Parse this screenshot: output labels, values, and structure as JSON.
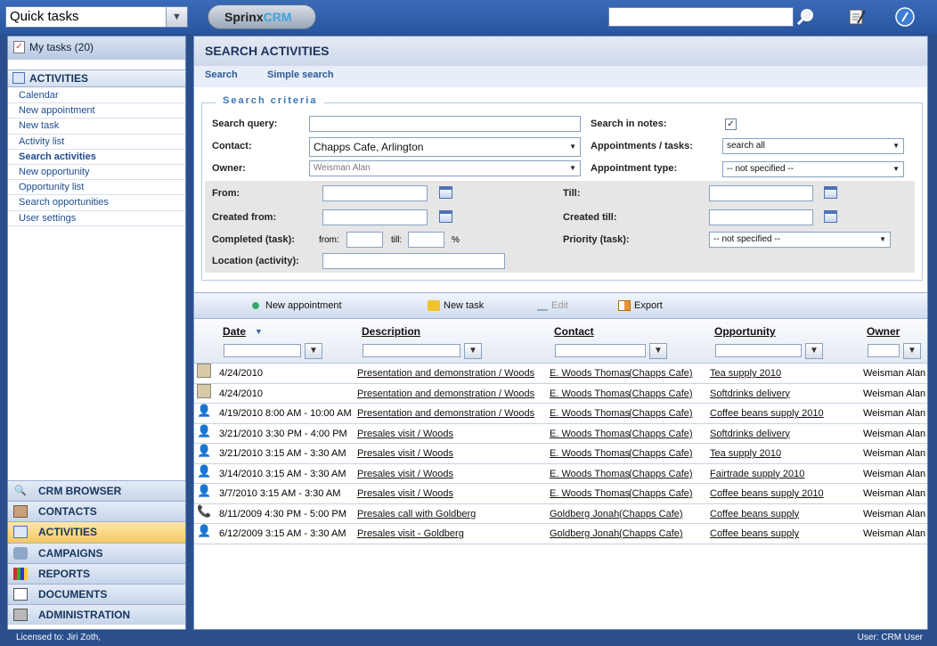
{
  "topbar": {
    "quick_tasks": "Quick tasks",
    "logo_part1": "Sprinx",
    "logo_part2": "CRM",
    "search_placeholder": ""
  },
  "sidebar": {
    "my_tasks": "My tasks (20)",
    "activities_header": "ACTIVITIES",
    "items": [
      {
        "label": "Calendar",
        "selected": false
      },
      {
        "label": "New appointment",
        "selected": false
      },
      {
        "label": "New task",
        "selected": false
      },
      {
        "label": "Activity list",
        "selected": false
      },
      {
        "label": "Search activities",
        "selected": true
      },
      {
        "label": "New opportunity",
        "selected": false
      },
      {
        "label": "Opportunity list",
        "selected": false
      },
      {
        "label": "Search opportunities",
        "selected": false
      },
      {
        "label": "User settings",
        "selected": false
      }
    ],
    "nav": [
      {
        "label": "CRM BROWSER",
        "icon": "magnifier-icon"
      },
      {
        "label": "CONTACTS",
        "icon": "contacts-icon"
      },
      {
        "label": "ACTIVITIES",
        "icon": "calendar-icon",
        "active": true
      },
      {
        "label": "CAMPAIGNS",
        "icon": "campaign-icon"
      },
      {
        "label": "REPORTS",
        "icon": "chart-icon"
      },
      {
        "label": "DOCUMENTS",
        "icon": "document-icon"
      },
      {
        "label": "ADMINISTRATION",
        "icon": "lock-icon"
      }
    ]
  },
  "main": {
    "title": "SEARCH ACTIVITIES",
    "tabs": [
      "Search",
      "Simple search"
    ],
    "criteria_label": "Search criteria",
    "labels": {
      "search_query": "Search query:",
      "contact": "Contact:",
      "owner": "Owner:",
      "search_in_notes": "Search in notes:",
      "appointments_tasks": "Appointments / tasks:",
      "appointment_type": "Appointment type:",
      "from": "From:",
      "till": "Till:",
      "created_from": "Created from:",
      "created_till": "Created till:",
      "completed": "Completed (task):",
      "completed_from": "from:",
      "completed_till": "till:",
      "percent": "%",
      "priority": "Priority (task):",
      "location": "Location (activity):"
    },
    "values": {
      "search_query": "",
      "contact": "Chapps Cafe, Arlington",
      "owner": "Weisman Alan",
      "search_in_notes": "✓",
      "appointments_tasks": "search all",
      "appointment_type": "-- not specified --",
      "priority": "-- not specified --"
    },
    "toolbar": {
      "new_appointment": "New appointment",
      "new_task": "New task",
      "edit": "Edit",
      "export": "Export"
    },
    "columns": {
      "date": "Date",
      "description": "Description",
      "contact": "Contact",
      "opportunity": "Opportunity",
      "owner": "Owner"
    },
    "rows": [
      {
        "icon": "task-icon",
        "date": "4/24/2010",
        "description": "Presentation and demonstration / Woods",
        "contact": "E. Woods Thomas",
        "company": "(Chapps Cafe)",
        "opportunity": "Tea supply 2010",
        "owner": "Weisman Alan"
      },
      {
        "icon": "task-icon",
        "date": "4/24/2010",
        "description": "Presentation and demonstration / Woods",
        "contact": "E. Woods Thomas",
        "company": "(Chapps Cafe)",
        "opportunity": "Softdrinks delivery",
        "owner": "Weisman Alan"
      },
      {
        "icon": "person-icon",
        "date": "4/19/2010 8:00 AM - 10:00 AM",
        "description": "Presentation and demonstration / Woods",
        "contact": "E. Woods Thomas",
        "company": "(Chapps Cafe)",
        "opportunity": "Coffee beans supply 2010",
        "owner": "Weisman Alan"
      },
      {
        "icon": "person-icon",
        "date": "3/21/2010 3:30 PM - 4:00 PM",
        "description": "Presales visit / Woods",
        "contact": "E. Woods Thomas",
        "company": "(Chapps Cafe)",
        "opportunity": "Softdrinks delivery",
        "owner": "Weisman Alan"
      },
      {
        "icon": "person-icon",
        "date": "3/21/2010 3:15 AM - 3:30 AM",
        "description": "Presales visit / Woods",
        "contact": "E. Woods Thomas",
        "company": "(Chapps Cafe)",
        "opportunity": "Tea supply 2010",
        "owner": "Weisman Alan"
      },
      {
        "icon": "person-icon",
        "date": "3/14/2010 3:15 AM - 3:30 AM",
        "description": "Presales visit / Woods",
        "contact": "E. Woods Thomas",
        "company": "(Chapps Cafe)",
        "opportunity": "Fairtrade supply 2010",
        "owner": "Weisman Alan"
      },
      {
        "icon": "person-icon",
        "date": "3/7/2010 3:15 AM - 3:30 AM",
        "description": "Presales visit / Woods",
        "contact": "E. Woods Thomas",
        "company": "(Chapps Cafe)",
        "opportunity": "Coffee beans supply 2010",
        "owner": "Weisman Alan"
      },
      {
        "icon": "phone-icon",
        "date": "8/11/2009 4:30 PM - 5:00 PM",
        "description": "Presales call with Goldberg",
        "contact": "Goldberg Jonah",
        "company": "(Chapps Cafe)",
        "opportunity": "Coffee beans supply",
        "owner": "Weisman Alan"
      },
      {
        "icon": "person-icon",
        "date": "6/12/2009 3:15 AM - 3:30 AM",
        "description": "Presales visit - Goldberg",
        "contact": "Goldberg Jonah",
        "company": "(Chapps Cafe)",
        "opportunity": "Coffee beans supply",
        "owner": "Weisman Alan"
      }
    ]
  },
  "status": {
    "licensed": "Licensed to: Jiri Zoth,",
    "user": "User: CRM User"
  }
}
